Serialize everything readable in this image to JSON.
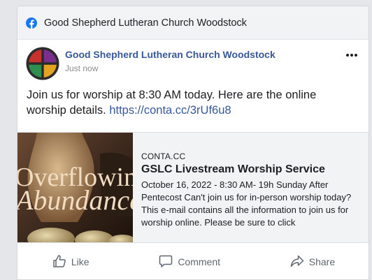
{
  "topbar": {
    "title": "Good Shepherd Lutheran Church Woodstock",
    "icon": "facebook-icon",
    "color": "#1877f2"
  },
  "post": {
    "page_name": "Good Shepherd Lutheran Church Woodstock",
    "timestamp": "Just now",
    "text": "Join us for worship at 8:30 AM today.  Here are the online worship details.  ",
    "link_text": "https://conta.cc/3rUf6u8"
  },
  "link_preview": {
    "image_text_line1": "Overflowing",
    "image_text_line2": "Abundance",
    "domain": "CONTA.CC",
    "title": "GSLC Livestream Worship Service",
    "description": "October 16, 2022 - 8:30 AM- 19h Sunday After Pentecost  Can't join us for in-person worship today? This e-mail contains all the information to join us for worship online. Please be sure to click"
  },
  "actions": {
    "like": "Like",
    "comment": "Comment",
    "share": "Share"
  },
  "colors": {
    "name_link": "#385898",
    "url_link": "#365899",
    "muted": "#606770"
  }
}
